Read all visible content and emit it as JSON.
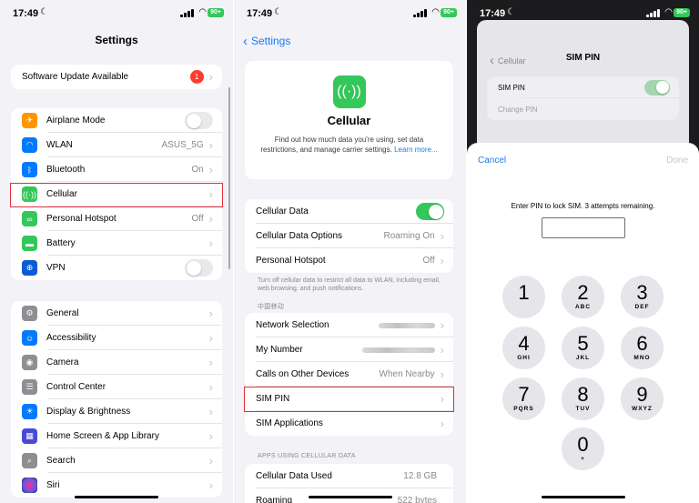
{
  "status": {
    "time": "17:49",
    "battery": "90+"
  },
  "settings": {
    "title": "Settings",
    "update": {
      "label": "Software Update Available",
      "badge": "1"
    },
    "group1": [
      {
        "label": "Airplane Mode",
        "icon": "airplane-icon",
        "color": "#ff9500"
      },
      {
        "label": "WLAN",
        "value": "ASUS_5G",
        "icon": "wifi-icon",
        "color": "#007aff"
      },
      {
        "label": "Bluetooth",
        "value": "On",
        "icon": "bluetooth-icon",
        "color": "#007aff"
      },
      {
        "label": "Cellular",
        "icon": "antenna-icon",
        "color": "#34c759"
      },
      {
        "label": "Personal Hotspot",
        "value": "Off",
        "icon": "hotspot-icon",
        "color": "#34c759"
      },
      {
        "label": "Battery",
        "icon": "battery-icon",
        "color": "#34c759"
      },
      {
        "label": "VPN",
        "icon": "vpn-globe-icon",
        "color": "#0a5bd6"
      }
    ],
    "group2": [
      {
        "label": "General",
        "icon": "gear-icon",
        "color": "#8e8e93"
      },
      {
        "label": "Accessibility",
        "icon": "accessibility-icon",
        "color": "#007aff"
      },
      {
        "label": "Camera",
        "icon": "camera-icon",
        "color": "#8e8e93"
      },
      {
        "label": "Control Center",
        "icon": "sliders-icon",
        "color": "#8e8e93"
      },
      {
        "label": "Display & Brightness",
        "icon": "sun-icon",
        "color": "#007aff"
      },
      {
        "label": "Home Screen & App Library",
        "icon": "home-grid-icon",
        "color": "#4a4ad8"
      },
      {
        "label": "Search",
        "icon": "search-icon",
        "color": "#8e8e93"
      },
      {
        "label": "Siri",
        "icon": "siri-icon",
        "color": "#2b2b3a"
      }
    ]
  },
  "cellular": {
    "back": "Settings",
    "title": "Cellular",
    "description": "Find out how much data you're using, set data restrictions, and manage carrier settings.",
    "learn_more": "Learn more...",
    "group1": [
      {
        "label": "Cellular Data"
      },
      {
        "label": "Cellular Data Options",
        "value": "Roaming On"
      },
      {
        "label": "Personal Hotspot",
        "value": "Off"
      }
    ],
    "footer": "Turn off cellular data to restrict all data to WLAN, including email, web browsing, and push notifications.",
    "carrier_header": "中国移动",
    "group2": [
      {
        "label": "Network Selection"
      },
      {
        "label": "My Number"
      },
      {
        "label": "Calls on Other Devices",
        "value": "When Nearby"
      },
      {
        "label": "SIM PIN"
      },
      {
        "label": "SIM Applications"
      }
    ],
    "apps_header": "APPS USING CELLULAR DATA",
    "group3": [
      {
        "label": "Cellular Data Used",
        "value": "12.8 GB"
      },
      {
        "label": "Roaming",
        "value": "522 bytes"
      }
    ]
  },
  "simpin": {
    "back": "Cellular",
    "title": "SIM PIN",
    "toggle_label": "SIM PIN",
    "change_label": "Change PIN",
    "cancel": "Cancel",
    "done": "Done",
    "prompt": "Enter PIN to lock SIM. 3 attempts remaining.",
    "keys": [
      {
        "digit": "1",
        "letters": ""
      },
      {
        "digit": "2",
        "letters": "ABC"
      },
      {
        "digit": "3",
        "letters": "DEF"
      },
      {
        "digit": "4",
        "letters": "GHI"
      },
      {
        "digit": "5",
        "letters": "JKL"
      },
      {
        "digit": "6",
        "letters": "MNO"
      },
      {
        "digit": "7",
        "letters": "PQRS"
      },
      {
        "digit": "8",
        "letters": "TUV"
      },
      {
        "digit": "9",
        "letters": "WXYZ"
      },
      {
        "digit": "0",
        "letters": "+"
      }
    ]
  }
}
